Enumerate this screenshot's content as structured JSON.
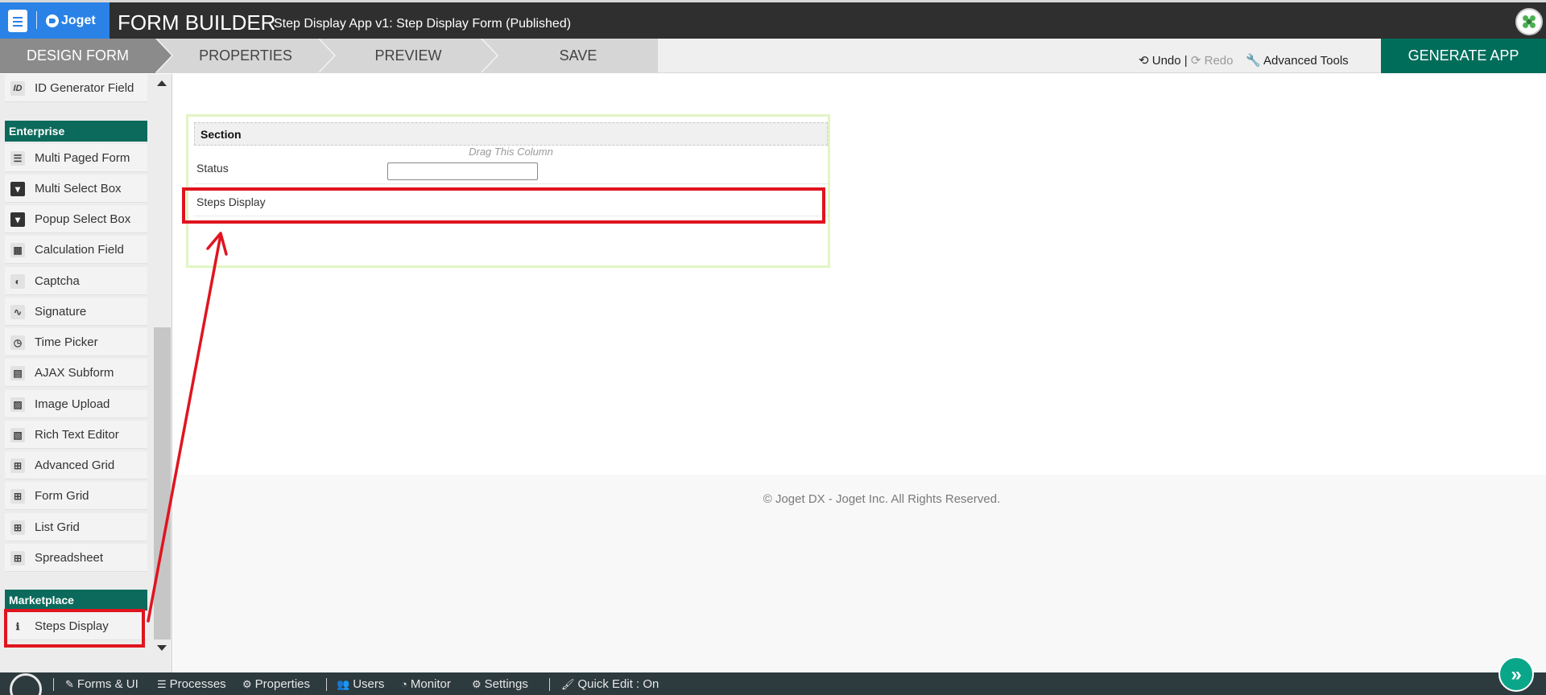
{
  "header": {
    "logo_text": "Joget",
    "title": "FORM BUILDER",
    "subtitle": "Step Display App v1: Step Display Form (Published)"
  },
  "steps": {
    "design": "DESIGN FORM",
    "properties": "PROPERTIES",
    "preview": "PREVIEW",
    "save": "SAVE"
  },
  "toolbar": {
    "undo": "Undo",
    "separator": "|",
    "redo": "Redo",
    "advanced": "Advanced Tools",
    "generate": "GENERATE APP"
  },
  "sidebar": {
    "items_top": [
      {
        "label": "ID Generator Field",
        "icon": "ID"
      }
    ],
    "enterprise_heading": "Enterprise",
    "enterprise_items": [
      {
        "label": "Multi Paged Form",
        "icon": "list-icon"
      },
      {
        "label": "Multi Select Box",
        "icon": "caret-box-icon"
      },
      {
        "label": "Popup Select Box",
        "icon": "caret-box-icon"
      },
      {
        "label": "Calculation Field",
        "icon": "calculator-icon"
      },
      {
        "label": "Captcha",
        "icon": "shield-icon"
      },
      {
        "label": "Signature",
        "icon": "signature-icon"
      },
      {
        "label": "Time Picker",
        "icon": "clock-icon"
      },
      {
        "label": "AJAX Subform",
        "icon": "file-icon"
      },
      {
        "label": "Image Upload",
        "icon": "image-icon"
      },
      {
        "label": "Rich Text Editor",
        "icon": "rich-text-icon"
      },
      {
        "label": "Advanced Grid",
        "icon": "grid-icon"
      },
      {
        "label": "Form Grid",
        "icon": "grid-icon"
      },
      {
        "label": "List Grid",
        "icon": "grid-icon"
      },
      {
        "label": "Spreadsheet",
        "icon": "grid-icon"
      }
    ],
    "marketplace_heading": "Marketplace",
    "marketplace_items": [
      {
        "label": "Steps Display",
        "icon": "info-icon"
      }
    ]
  },
  "form": {
    "section_title": "Section",
    "drag_column": "Drag This Column",
    "status_label": "Status",
    "status_value": "",
    "steps_label": "Steps Display"
  },
  "footer": {
    "copyright": "© Joget DX - Joget Inc. All Rights Reserved."
  },
  "bottom_nav": {
    "items": [
      {
        "label": "Forms & UI",
        "icon": "edit-icon"
      },
      {
        "label": "Processes",
        "icon": "list-icon"
      },
      {
        "label": "Properties",
        "icon": "gear-icon"
      },
      {
        "label": "Users",
        "icon": "users-icon"
      },
      {
        "label": "Monitor",
        "icon": "dashboard-icon"
      },
      {
        "label": "Settings",
        "icon": "gears-icon"
      },
      {
        "label": "Quick Edit : On",
        "icon": "brush-icon"
      }
    ]
  },
  "colors": {
    "header_bg": "#2f2f2f",
    "brand_blue": "#2a82e6",
    "accent_green": "#006d5b",
    "highlight_red": "#e0141f",
    "bottom_nav_bg": "#2d3a3e",
    "fab_teal": "#0aa68a"
  }
}
